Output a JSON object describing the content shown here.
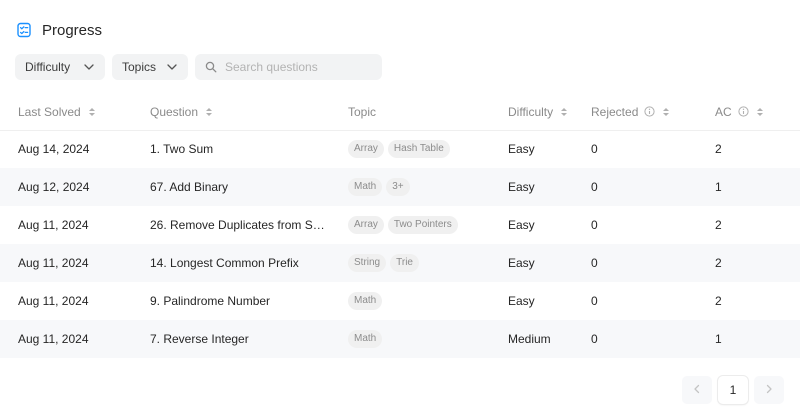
{
  "header": {
    "title": "Progress",
    "icon": "checklist-icon"
  },
  "filters": {
    "difficulty_label": "Difficulty",
    "topics_label": "Topics",
    "search_placeholder": "Search questions"
  },
  "table": {
    "columns": {
      "last_solved": "Last Solved",
      "question": "Question",
      "topic": "Topic",
      "difficulty": "Difficulty",
      "rejected": "Rejected",
      "ac": "AC"
    },
    "rows": [
      {
        "date": "Aug 14, 2024",
        "question": "1. Two Sum",
        "tags": [
          "Array",
          "Hash Table"
        ],
        "difficulty": "Easy",
        "rejected": "0",
        "ac": "2"
      },
      {
        "date": "Aug 12, 2024",
        "question": "67. Add Binary",
        "tags": [
          "Math",
          "3+"
        ],
        "difficulty": "Easy",
        "rejected": "0",
        "ac": "1"
      },
      {
        "date": "Aug 11, 2024",
        "question": "26. Remove Duplicates from Sor...",
        "tags": [
          "Array",
          "Two Pointers"
        ],
        "difficulty": "Easy",
        "rejected": "0",
        "ac": "2"
      },
      {
        "date": "Aug 11, 2024",
        "question": "14. Longest Common Prefix",
        "tags": [
          "String",
          "Trie"
        ],
        "difficulty": "Easy",
        "rejected": "0",
        "ac": "2"
      },
      {
        "date": "Aug 11, 2024",
        "question": "9. Palindrome Number",
        "tags": [
          "Math"
        ],
        "difficulty": "Easy",
        "rejected": "0",
        "ac": "2"
      },
      {
        "date": "Aug 11, 2024",
        "question": "7. Reverse Integer",
        "tags": [
          "Math"
        ],
        "difficulty": "Medium",
        "rejected": "0",
        "ac": "1"
      }
    ]
  },
  "pagination": {
    "current_page": "1"
  },
  "colors": {
    "easy": "#1cb8b8",
    "medium": "#ffb700",
    "accent": "#1a90ff"
  }
}
